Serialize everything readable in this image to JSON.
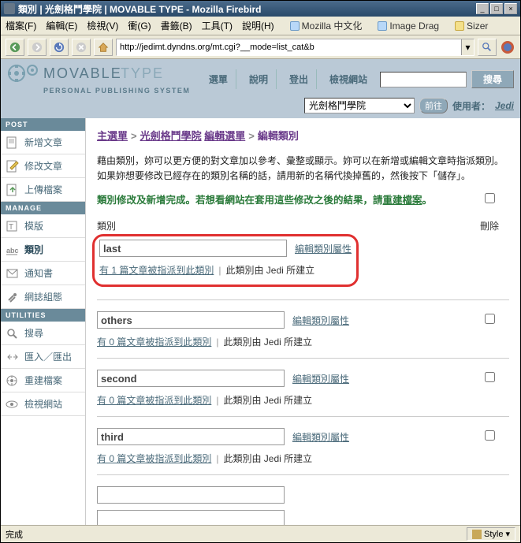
{
  "window": {
    "title": "類別 | 光劍格鬥學院 | MOVABLE TYPE - Mozilla Firebird"
  },
  "menu": {
    "file": "檔案(F)",
    "edit": "編輯(E)",
    "view": "檢視(V)",
    "go": "衝(G)",
    "bookmarks": "書籤(B)",
    "tools": "工具(T)",
    "help": "說明(H)"
  },
  "bookmarkbar": {
    "b1": "Mozilla 中文化",
    "b2": "Image Drag",
    "b3": "Sizer"
  },
  "url": "http://jedimt.dyndns.org/mt.cgi?__mode=list_cat&b",
  "mt": {
    "logo": "MOVABLETYPE",
    "tagline": "PERSONAL PUBLISHING SYSTEM",
    "nav": {
      "menu": "選單",
      "help": "說明",
      "logout": "登出",
      "viewsite": "檢視網站",
      "search": "搜尋"
    },
    "blog_select": "光劍格鬥學院",
    "go": "前往",
    "user_label": "使用者：",
    "user": "Jedi"
  },
  "sidebar": {
    "post": "POST",
    "manage": "MANAGE",
    "utilities": "UTILITIES",
    "items": {
      "new_entry": "新增文章",
      "edit_entry": "修改文章",
      "upload": "上傳檔案",
      "templates": "模版",
      "categories": "類別",
      "notify": "通知書",
      "config": "網誌組態",
      "search": "搜尋",
      "import": "匯入／匯出",
      "rebuild": "重建檔案",
      "viewsite": "檢視網站"
    }
  },
  "breadcrumb": {
    "main": "主選單",
    "blog": "光劍格鬥學院",
    "edit": "編輯選單",
    "current": "編輯類別"
  },
  "instructions": "藉由類別，妳可以更方便的對文章加以參考、彙整或顯示。妳可以在新增或編輯文章時指派類別。如果妳想要修改已經存在的類別名稱的話，請用新的名稱代換掉舊的，然後按下「儲存」。",
  "notice": {
    "text": "類別修改及新增完成。若想看網站在套用這些修改之後的結果，請",
    "link": "重建檔案",
    "suffix": "。"
  },
  "headers": {
    "category": "類別",
    "delete": "刪除"
  },
  "edit_attr": "編輯類別屬性",
  "cats": [
    {
      "name": "last",
      "count_text": "有 1 篇文章被指派到此類別",
      "creator_text": "此類別由 Jedi 所建立"
    },
    {
      "name": "others",
      "count_text": "有 0 篇文章被指派到此類別",
      "creator_text": "此類別由 Jedi 所建立"
    },
    {
      "name": "second",
      "count_text": "有 0 篇文章被指派到此類別",
      "creator_text": "此類別由 Jedi 所建立"
    },
    {
      "name": "third",
      "count_text": "有 0 篇文章被指派到此類別",
      "creator_text": "此類別由 Jedi 所建立"
    }
  ],
  "statusbar": {
    "done": "完成",
    "style": "Style"
  }
}
